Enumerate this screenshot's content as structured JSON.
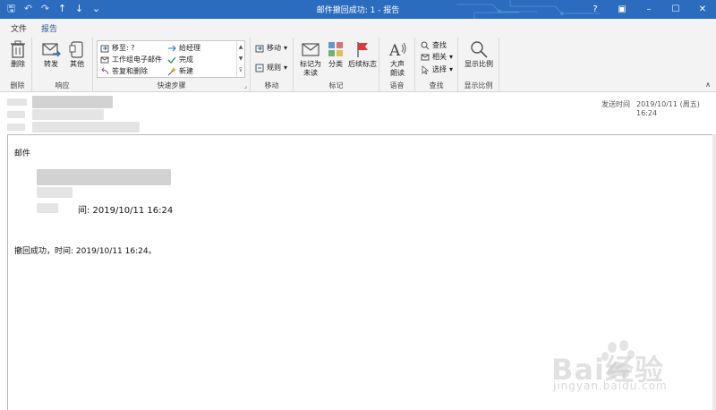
{
  "titlebar": {
    "title": "邮件撤回成功: 1  -  报告",
    "qat_save": "🖫",
    "qat_undo": "↶",
    "qat_redo": "↷",
    "qat_up": "↑",
    "qat_down": "↓",
    "qat_more": "⌄",
    "help": "?",
    "ribbon_toggle": "▣",
    "minimize": "–",
    "maximize": "☐",
    "close": "✕"
  },
  "tabs": [
    "文件",
    "报告"
  ],
  "ribbon": {
    "delete": {
      "label": "删除",
      "group": "删除"
    },
    "respond": {
      "forward": "转发",
      "other": "其他",
      "group": "响应"
    },
    "quicksteps": {
      "items": [
        "移至: ?",
        "给经理",
        "工作组电子邮件",
        "完成",
        "答复和删除",
        "新建"
      ],
      "group": "快速步骤"
    },
    "move": {
      "move": "移动",
      "rules": "规则",
      "group": "移动"
    },
    "tags": {
      "mark_unread": "标记为未读",
      "categorize": "分类",
      "followup": "后续标志",
      "group": "标记"
    },
    "speech": {
      "read_aloud": "大声朗读",
      "group": "语音"
    },
    "find": {
      "find": "查找",
      "related": "相关",
      "select": "选择",
      "group": "查找"
    },
    "zoom": {
      "label": "显示比例",
      "group": "显示比例"
    }
  },
  "header": {
    "sent_label": "发送时间",
    "sent_value": "2019/10/11 (周五) 16:24"
  },
  "body": {
    "title": "邮件",
    "time_line": "间:  2019/10/11 16:24",
    "result": "撤回成功，时间: 2019/10/11 16:24。"
  },
  "watermark": {
    "brand": "Bai经验",
    "url": "jingyan.baidu.com"
  },
  "colors": {
    "titlebar": "#2b6cbf",
    "accent": "#2b579a",
    "ribbon_bg": "#f3f3f3"
  }
}
